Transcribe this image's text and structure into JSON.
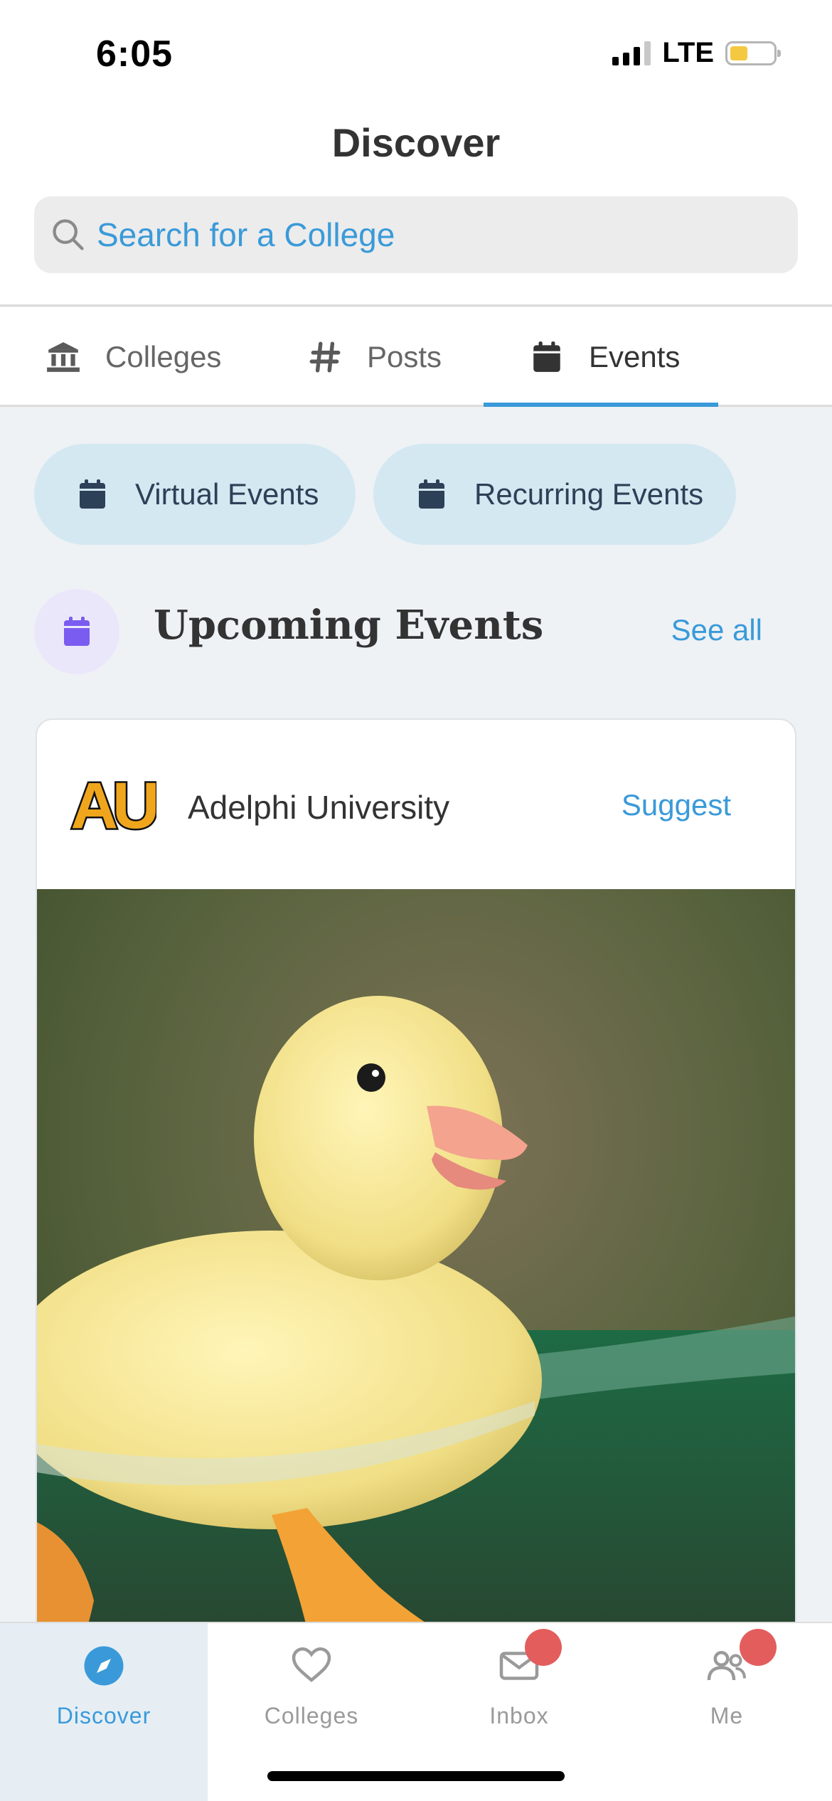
{
  "status_bar": {
    "time": "6:05",
    "network": "LTE"
  },
  "header": {
    "title": "Discover"
  },
  "search": {
    "placeholder": "Search for a College"
  },
  "tabs": [
    {
      "label": "Colleges",
      "icon": "institution-icon",
      "active": false
    },
    {
      "label": "Posts",
      "icon": "hashtag-icon",
      "active": false
    },
    {
      "label": "Events",
      "icon": "calendar-icon",
      "active": true
    }
  ],
  "filter_chips": [
    {
      "label": "Virtual Events",
      "icon": "calendar-icon"
    },
    {
      "label": "Recurring Events",
      "icon": "calendar-icon"
    }
  ],
  "section": {
    "title": "Upcoming Events",
    "see_all": "See all",
    "icon": "calendar-icon"
  },
  "event_card": {
    "college_name": "Adelphi University",
    "suggest_label": "Suggest",
    "logo_text": "AU",
    "image_subject": "duckling swimming in water"
  },
  "bottom_nav": [
    {
      "label": "Discover",
      "icon": "compass-icon",
      "active": true,
      "badge": false
    },
    {
      "label": "Colleges",
      "icon": "heart-icon",
      "active": false,
      "badge": false
    },
    {
      "label": "Inbox",
      "icon": "envelope-icon",
      "active": false,
      "badge": true
    },
    {
      "label": "Me",
      "icon": "people-icon",
      "active": false,
      "badge": true
    }
  ],
  "colors": {
    "accent": "#3a9ad9",
    "chip_bg": "#d4e8f2",
    "chip_text": "#2c4057",
    "section_icon": "#7b5cf0",
    "badge": "#e35d5d",
    "battery": "#f5c842"
  }
}
